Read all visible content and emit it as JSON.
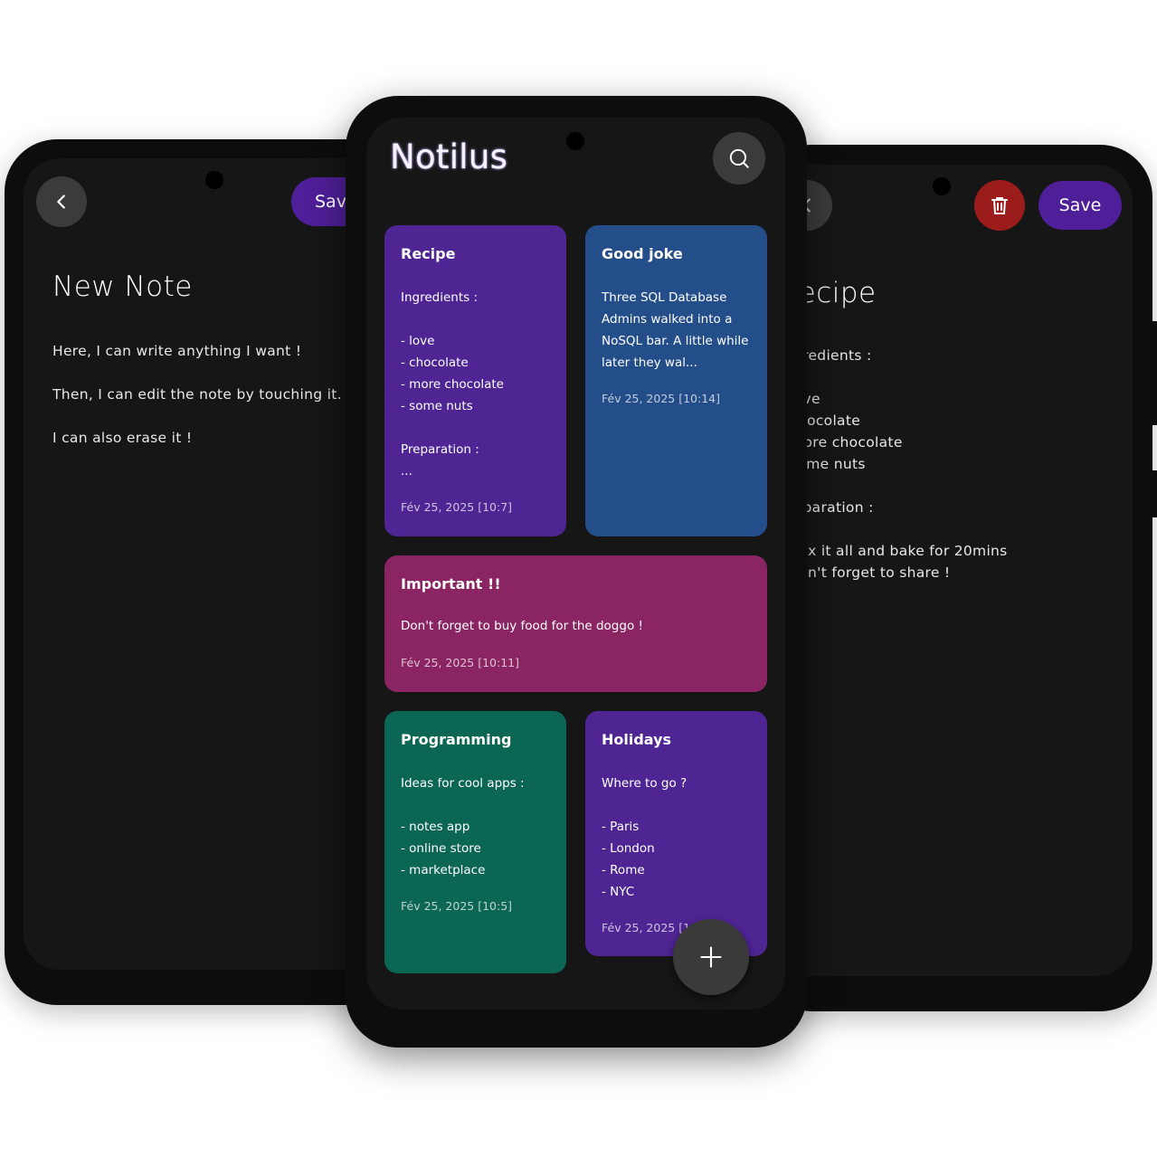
{
  "left_screen": {
    "save_label": "Save",
    "title": "New Note",
    "body": "Here, I can write anything I want !\n\nThen, I can edit the note by touching it.\n\nI can also erase it !"
  },
  "center_screen": {
    "app_title": "Notilus",
    "notes": [
      {
        "title": "Recipe",
        "body": "Ingredients :\n\n- love\n- chocolate\n- more chocolate\n- some nuts\n\nPreparation :\n...",
        "date": "Fév 25, 2025 [10:7]",
        "color": "#4f2594"
      },
      {
        "title": "Good joke",
        "body": "Three SQL Database\nAdmins walked into a\nNoSQL bar. A little while\nlater they wal...",
        "date": "Fév 25, 2025 [10:14]",
        "color": "#234e8a"
      },
      {
        "title": "Important !!",
        "body": "Don't forget to buy food for the doggo !",
        "date": "Fév 25, 2025 [10:11]",
        "color": "#8a2463"
      },
      {
        "title": "Programming",
        "body": "Ideas for cool apps :\n\n- notes app\n- online store\n- marketplace",
        "date": "Fév 25, 2025 [10:5]",
        "color": "#0c6654"
      },
      {
        "title": "Holidays",
        "body": "Where to go ?\n\n- Paris\n- London\n- Rome\n- NYC",
        "date": "Fév 25, 2025 [1",
        "color": "#4f2594"
      }
    ]
  },
  "right_screen": {
    "save_label": "Save",
    "title": "Recipe",
    "body": "Ingredients :\n\n- love\n- chocolate\n- more chocolate\n- some nuts\n\nPreparation :\n\n- mix it all and bake for 20mins\n- don't forget to share !",
    "delete_color": "#9c1c1c"
  }
}
